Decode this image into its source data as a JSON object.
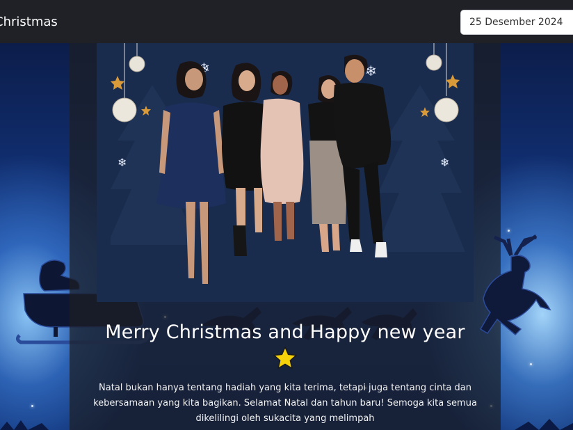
{
  "header": {
    "brand": "Christmas",
    "date_value": "25 Desember 2024"
  },
  "greeting": {
    "title": "Merry Christmas and Happy new year",
    "star_icon": "star-icon",
    "message": "Natal bukan hanya tentang hadiah yang kita terima, tetapi juga tentang cinta dan kebersamaan yang kita bagikan. Selamat Natal dan tahun baru! Semoga kita semua dikelilingi oleh sukacita yang melimpah"
  },
  "colors": {
    "navbar": "#1f2126",
    "photo_background": "#1a2c4e",
    "star": "#f5d20a"
  }
}
